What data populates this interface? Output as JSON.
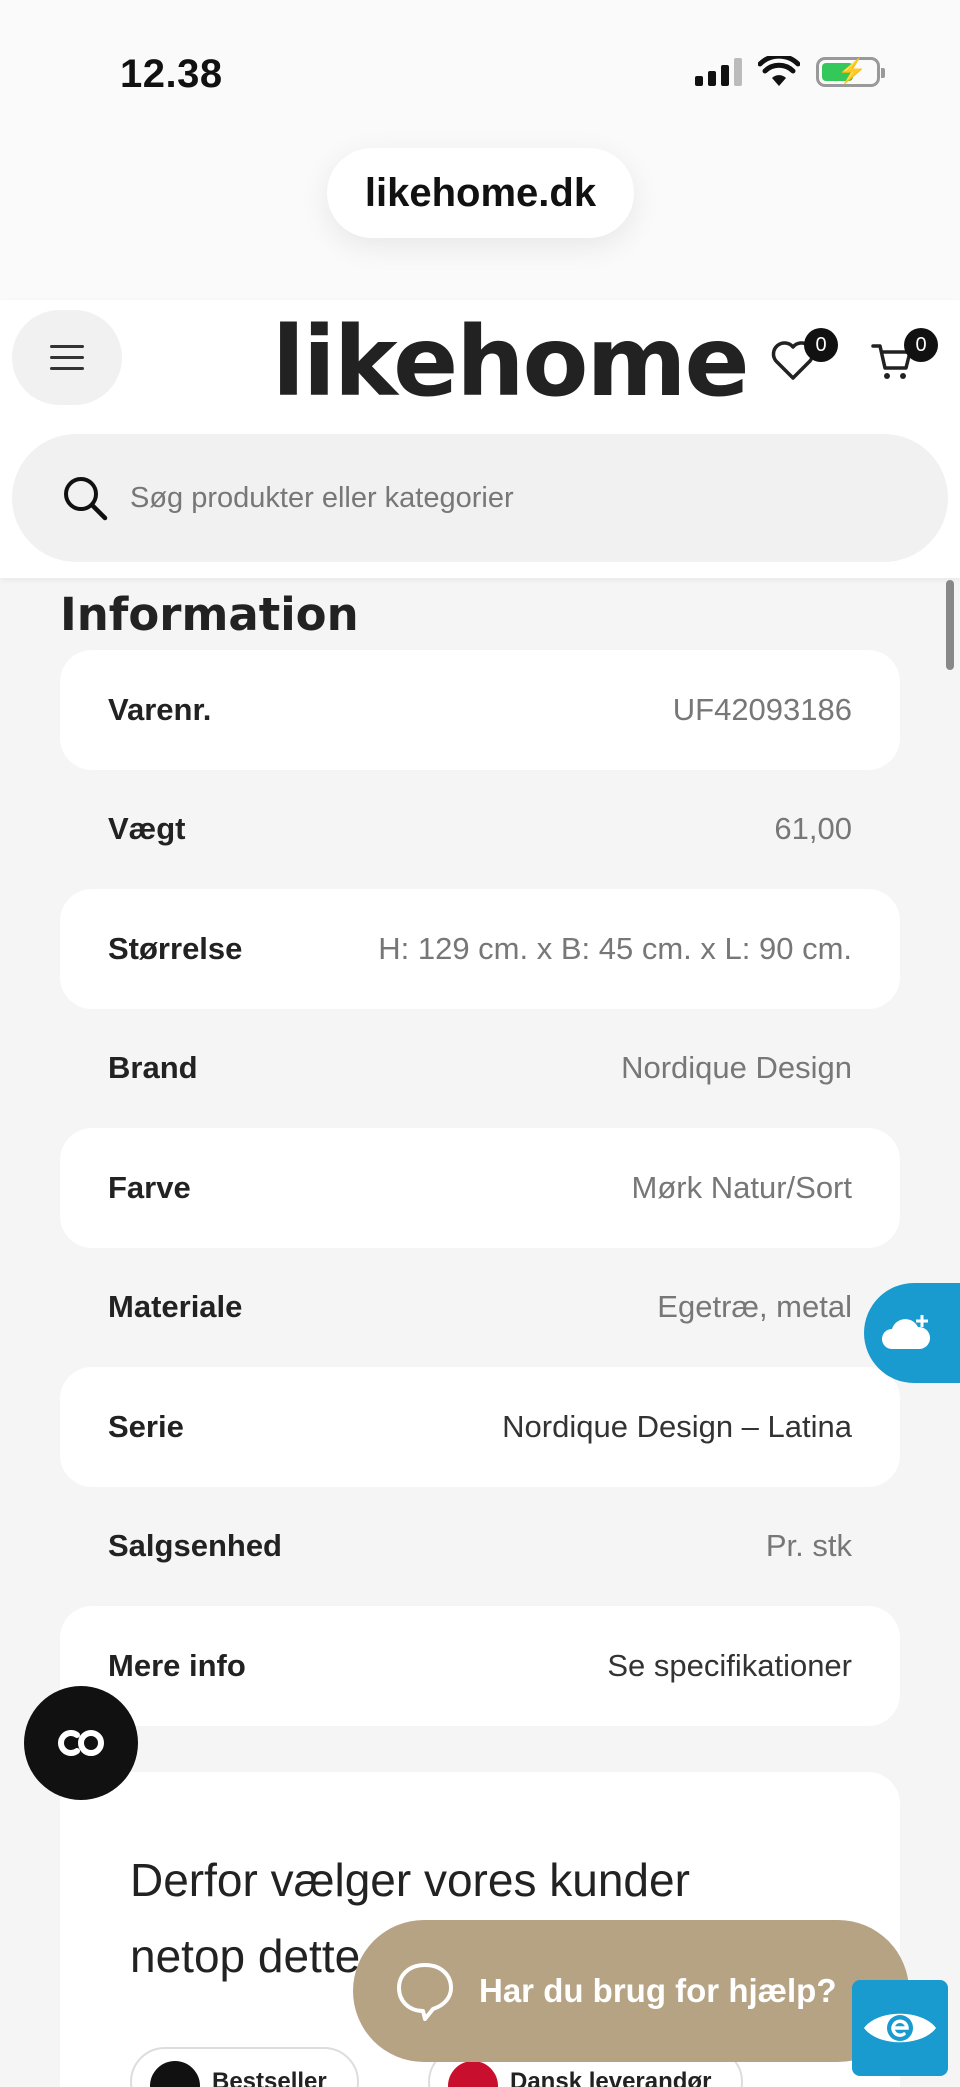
{
  "status_bar": {
    "time": "12.38"
  },
  "browser": {
    "url": "likehome.dk"
  },
  "header": {
    "logo": "likehome",
    "wishlist_count": "0",
    "cart_count": "0",
    "search_placeholder": "Søg produkter eller kategorier"
  },
  "information": {
    "title": "Information",
    "rows": [
      {
        "label": "Varenr.",
        "value": "UF42093186"
      },
      {
        "label": "Vægt",
        "value": "61,00"
      },
      {
        "label": "Størrelse",
        "value": "H: 129 cm. x B: 45 cm. x L: 90 cm."
      },
      {
        "label": "Brand",
        "value": "Nordique Design"
      },
      {
        "label": "Farve",
        "value": "Mørk Natur/Sort"
      },
      {
        "label": "Materiale",
        "value": "Egetræ, metal"
      },
      {
        "label": "Serie",
        "value": "Nordique Design – Latina"
      },
      {
        "label": "Salgsenhed",
        "value": "Pr. stk"
      },
      {
        "label": "Mere info",
        "value": "Se specifikationer"
      }
    ]
  },
  "why_section": {
    "title": "Derfor vælger vores kunder netop dette",
    "chips": [
      {
        "label": "Bestseller"
      },
      {
        "label": "Dansk leverandør"
      }
    ]
  },
  "help": {
    "label": "Har du brug for hjælp?"
  },
  "colors": {
    "accent_blue": "#1a9bd0",
    "help_tan": "#b6a384",
    "badge_black": "#111111"
  }
}
